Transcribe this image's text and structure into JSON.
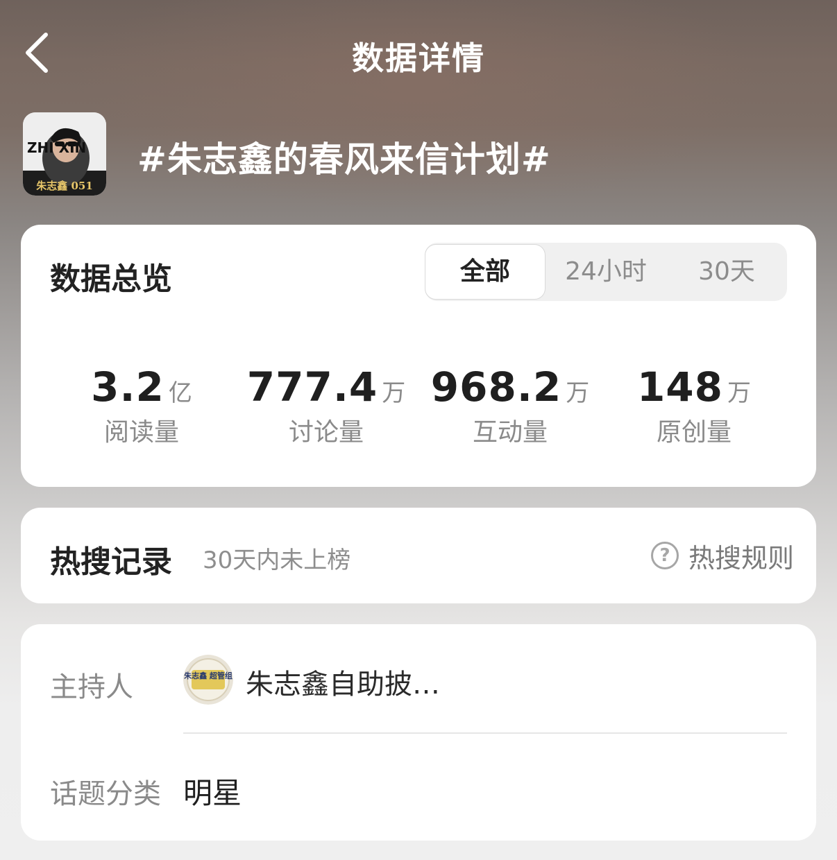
{
  "nav": {
    "title": "数据详情",
    "back_icon": "chevron-left-icon"
  },
  "topic": {
    "title": "#朱志鑫的春风来信计划#",
    "avatar_caption": "朱志鑫 051",
    "avatar_logo_text": "ZHI XIN"
  },
  "overview": {
    "title": "数据总览",
    "tabs": [
      {
        "label": "全部",
        "active": true
      },
      {
        "label": "24小时",
        "active": false
      },
      {
        "label": "30天",
        "active": false
      }
    ],
    "stats": [
      {
        "value": "3.2",
        "unit": "亿",
        "label": "阅读量"
      },
      {
        "value": "777.4",
        "unit": "万",
        "label": "讨论量"
      },
      {
        "value": "968.2",
        "unit": "万",
        "label": "互动量"
      },
      {
        "value": "148",
        "unit": "万",
        "label": "原创量"
      }
    ]
  },
  "hot_search": {
    "title": "热搜记录",
    "status": "30天内未上榜",
    "rules_label": "热搜规则",
    "rules_icon": "question-circle-icon"
  },
  "info": {
    "host_label": "主持人",
    "host_name": "朱志鑫自助披…",
    "host_avatar_text": "朱志鑫 超管组",
    "category_label": "话题分类",
    "category_value": "明星"
  },
  "colors": {
    "card_bg": "#ffffff",
    "text_primary": "#1f1f1f",
    "text_secondary": "#8a8a8a",
    "segment_bg": "#f0f0f0"
  }
}
